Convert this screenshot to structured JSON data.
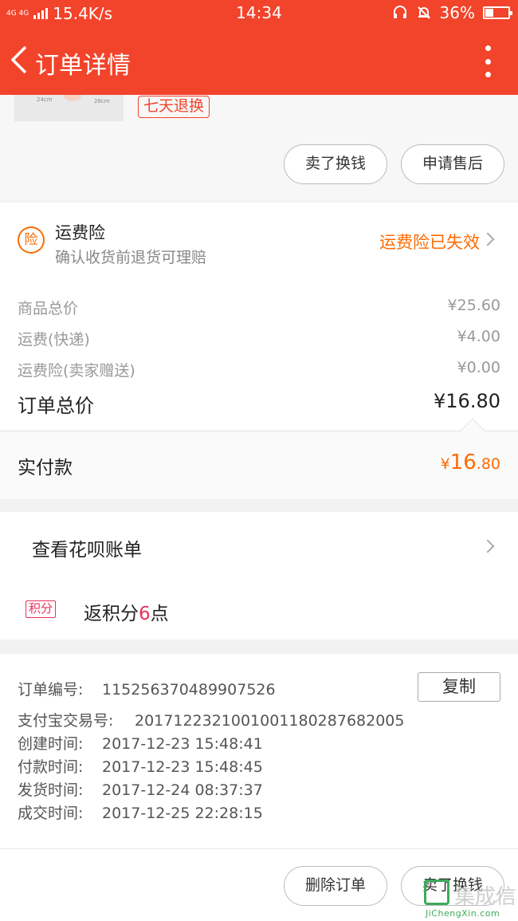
{
  "status_bar": {
    "network": "4G 4G",
    "speed": "15.4K/s",
    "time": "14:34",
    "battery": "36%",
    "battery_level": 0.36
  },
  "header": {
    "title": "订单详情"
  },
  "goods": {
    "thumb_label_1": "24cm",
    "thumb_label_2": "28cm",
    "return_tag": "七天退换",
    "buttons": [
      "卖了换钱",
      "申请售后"
    ]
  },
  "insurance": {
    "icon_char": "险",
    "title": "运费险",
    "subtitle": "确认收货前退货可理赔",
    "status": "运费险已失效"
  },
  "prices": {
    "rows": [
      {
        "label": "商品总价",
        "value": "¥25.60"
      },
      {
        "label": "运费(快递)",
        "value": "¥4.00"
      },
      {
        "label": "运费险(卖家赠送)",
        "value": "¥0.00"
      }
    ],
    "total_label": "订单总价",
    "total_value": "¥16.80"
  },
  "payment": {
    "label": "实付款",
    "currency": "¥",
    "integer": "16",
    "decimal": ".80"
  },
  "huabei": {
    "label": "查看花呗账单"
  },
  "points": {
    "badge": "积分",
    "prefix": "返积分",
    "count": "6",
    "suffix": "点"
  },
  "order_info": {
    "copy_label": "复制",
    "rows": [
      {
        "label": "订单编号:",
        "value": "115256370489907526"
      },
      {
        "label": "支付宝交易号:",
        "value": "2017122321001001180287682005"
      },
      {
        "label": "创建时间:",
        "value": "2017-12-23 15:48:41"
      },
      {
        "label": "付款时间:",
        "value": "2017-12-23 15:48:45"
      },
      {
        "label": "发货时间:",
        "value": "2017-12-24 08:37:37"
      },
      {
        "label": "成交时间:",
        "value": "2017-12-25 22:28:15"
      }
    ]
  },
  "actions": {
    "buttons": [
      "删除订单",
      "卖了换钱"
    ]
  },
  "watermark": {
    "cn": "集成信",
    "en": "JiChengXin.com"
  },
  "colors": {
    "brand": "#f2442b",
    "accent": "#ff6a00",
    "points": "#e8305a"
  }
}
